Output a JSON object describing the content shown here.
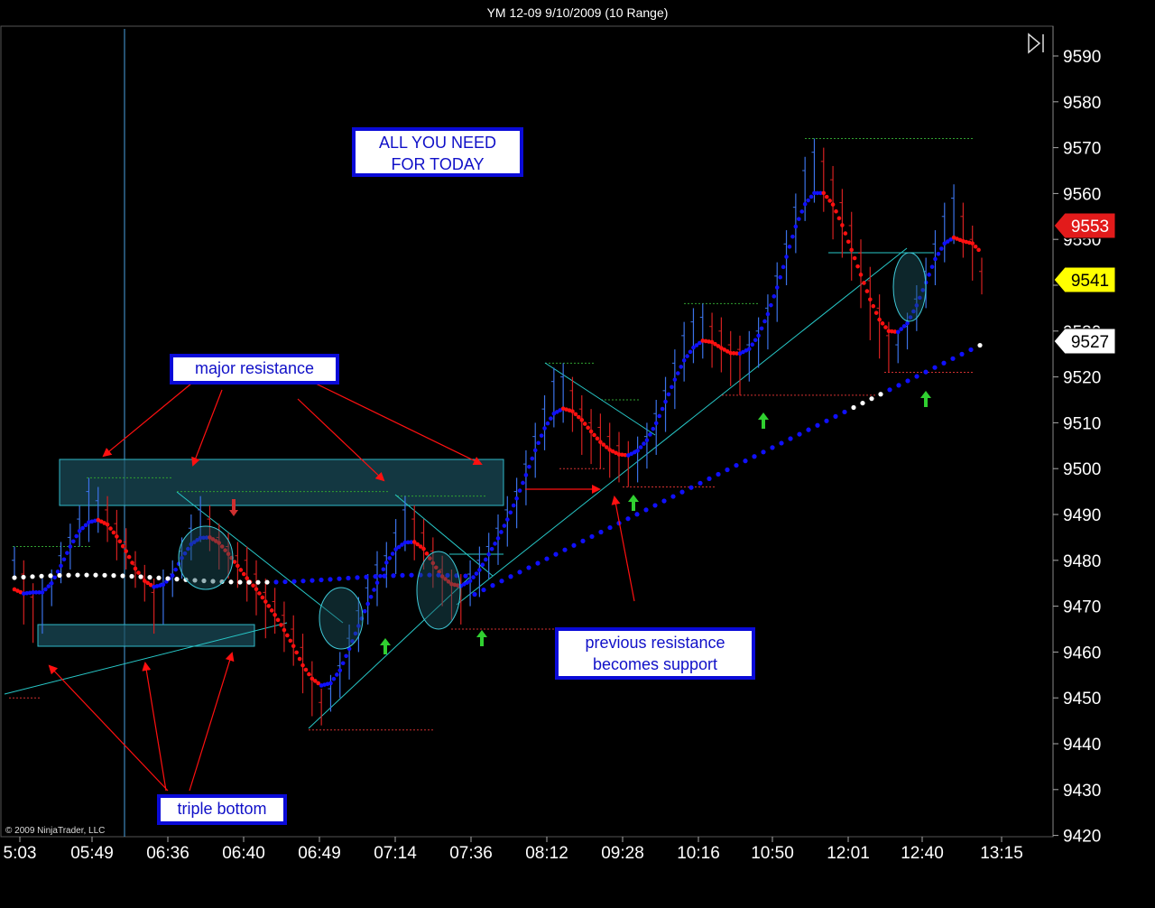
{
  "title": "YM 12-09  9/10/2009 (10 Range)",
  "copyright": "© 2009 NinjaTrader, LLC",
  "colors": {
    "background": "#000000",
    "bar_up": "#3b72e8",
    "bar_down": "#d42020",
    "bar_neutral": "#f2f2a0",
    "fast_ma_up": "#1010ff",
    "fast_ma_down": "#ff1010",
    "slow_ma": "#1010ff",
    "slow_ma_flat": "#ffffff",
    "trendline": "#27c7c7",
    "arrow": "#ff1010",
    "signal_arrow": "#30d030",
    "callout_border": "#0a0ad8",
    "callout_text": "#1010c8"
  },
  "callouts": {
    "main": "ALL YOU NEED\nFOR TODAY",
    "resistance": "major resistance",
    "support": "previous resistance\nbecomes support",
    "triple_bottom": "triple bottom"
  },
  "price_tags": [
    {
      "value": "9553",
      "bg": "#e21b1b",
      "fg": "#ffffff"
    },
    {
      "value": "9541",
      "bg": "#ffff00",
      "fg": "#000000"
    },
    {
      "value": "9527",
      "bg": "#ffffff",
      "fg": "#000000"
    }
  ],
  "chart_data": {
    "type": "candlestick",
    "y_ticks": [
      9590,
      9580,
      9570,
      9560,
      9550,
      9540,
      9530,
      9520,
      9510,
      9500,
      9490,
      9480,
      9470,
      9460,
      9450,
      9440,
      9430,
      9420
    ],
    "ylim": [
      9420,
      9596
    ],
    "x_ticks": [
      "5:03",
      "05:49",
      "06:36",
      "06:40",
      "06:49",
      "07:14",
      "07:36",
      "08:12",
      "09:28",
      "10:16",
      "10:50",
      "12:01",
      "12:40",
      "13:15"
    ],
    "grid": false,
    "bars": [
      [
        9483,
        9476
      ],
      [
        9480,
        9466
      ],
      [
        9475,
        9462
      ],
      [
        9476,
        9464
      ],
      [
        9478,
        9470
      ],
      [
        9484,
        9475
      ],
      [
        9488,
        9478
      ],
      [
        9492,
        9483
      ],
      [
        9498,
        9484
      ],
      [
        9496,
        9486
      ],
      [
        9494,
        9484
      ],
      [
        9491,
        9480
      ],
      [
        9487,
        9478
      ],
      [
        9482,
        9474
      ],
      [
        9479,
        9471
      ],
      [
        9476,
        9464
      ],
      [
        9478,
        9466
      ],
      [
        9480,
        9472
      ],
      [
        9485,
        9476
      ],
      [
        9490,
        9480
      ],
      [
        9494,
        9484
      ],
      [
        9492,
        9482
      ],
      [
        9488,
        9478
      ],
      [
        9486,
        9476
      ],
      [
        9484,
        9474
      ],
      [
        9483,
        9471
      ],
      [
        9480,
        9468
      ],
      [
        9476,
        9463
      ],
      [
        9474,
        9464
      ],
      [
        9471,
        9460
      ],
      [
        9468,
        9457
      ],
      [
        9464,
        9451
      ],
      [
        9458,
        9446
      ],
      [
        9452,
        9444
      ],
      [
        9455,
        9447
      ],
      [
        9460,
        9450
      ],
      [
        9466,
        9454
      ],
      [
        9472,
        9460
      ],
      [
        9477,
        9466
      ],
      [
        9482,
        9470
      ],
      [
        9484,
        9474
      ],
      [
        9489,
        9477
      ],
      [
        9494,
        9482
      ],
      [
        9492,
        9480
      ],
      [
        9489,
        9478
      ],
      [
        9485,
        9474
      ],
      [
        9481,
        9470
      ],
      [
        9478,
        9467
      ],
      [
        9477,
        9466
      ],
      [
        9480,
        9470
      ],
      [
        9483,
        9472
      ],
      [
        9486,
        9476
      ],
      [
        9490,
        9479
      ],
      [
        9494,
        9483
      ],
      [
        9498,
        9487
      ],
      [
        9504,
        9492
      ],
      [
        9510,
        9498
      ],
      [
        9516,
        9504
      ],
      [
        9522,
        9509
      ],
      [
        9523,
        9510
      ],
      [
        9520,
        9508
      ],
      [
        9516,
        9503
      ],
      [
        9513,
        9501
      ],
      [
        9512,
        9500
      ],
      [
        9510,
        9498
      ],
      [
        9508,
        9497
      ],
      [
        9506,
        9496
      ],
      [
        9507,
        9497
      ],
      [
        9510,
        9500
      ],
      [
        9515,
        9503
      ],
      [
        9520,
        9508
      ],
      [
        9526,
        9513
      ],
      [
        9532,
        9519
      ],
      [
        9535,
        9523
      ],
      [
        9536,
        9524
      ],
      [
        9534,
        9522
      ],
      [
        9533,
        9521
      ],
      [
        9530,
        9518
      ],
      [
        9529,
        9516
      ],
      [
        9530,
        9519
      ],
      [
        9533,
        9522
      ],
      [
        9538,
        9526
      ],
      [
        9545,
        9532
      ],
      [
        9552,
        9540
      ],
      [
        9560,
        9547
      ],
      [
        9568,
        9554
      ],
      [
        9572,
        9558
      ],
      [
        9570,
        9556
      ],
      [
        9566,
        9550
      ],
      [
        9561,
        9546
      ],
      [
        9556,
        9541
      ],
      [
        9550,
        9535
      ],
      [
        9544,
        9528
      ],
      [
        9538,
        9524
      ],
      [
        9532,
        9521
      ],
      [
        9530,
        9523
      ],
      [
        9534,
        9526
      ],
      [
        9540,
        9530
      ],
      [
        9546,
        9535
      ],
      [
        9552,
        9540
      ],
      [
        9558,
        9545
      ],
      [
        9562,
        9549
      ],
      [
        9558,
        9546
      ],
      [
        9553,
        9541
      ],
      [
        9546,
        9538
      ]
    ],
    "annotations": [
      "major resistance",
      "triple bottom",
      "previous resistance becomes support",
      "ALL YOU NEED FOR TODAY"
    ]
  }
}
